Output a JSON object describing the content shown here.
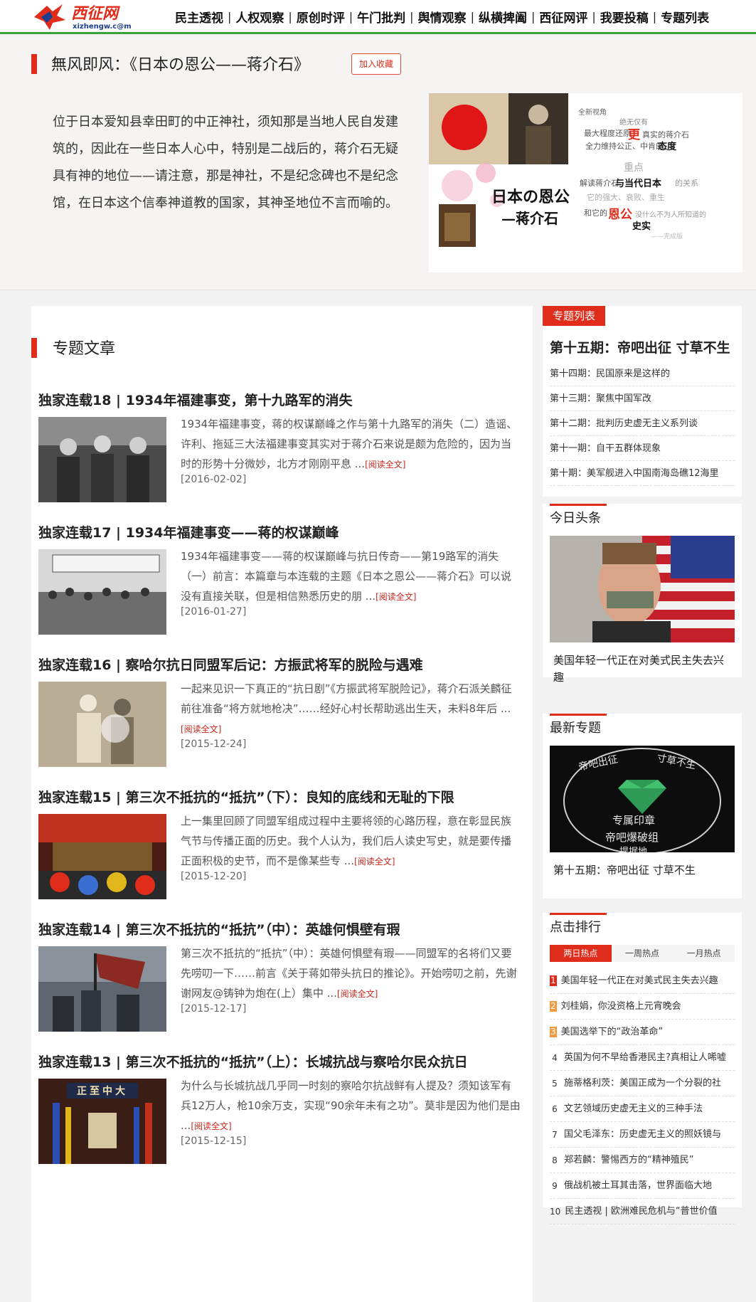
{
  "site": {
    "logo_text": "西征网",
    "logo_domain": "xizhengw.c@m"
  },
  "nav": [
    "民主透视",
    "人权观察",
    "原创时评",
    "午门批判",
    "舆情观察",
    "纵横捭阖",
    "西征网评",
    "我要投稿",
    "专题列表"
  ],
  "topic": {
    "title": "無风即风：《日本の恩公——蒋介石》",
    "favorite_label": "加入收藏",
    "description": "位于日本爱知县幸田町的中正神社，须知那是当地人民自发建筑的，因此在一些日本人心中，特别是二战后的，蒋介石无疑具有神的地位——请注意，那是神社，不是纪念碑也不是纪念馆，在日本这个信奉神道教的国家，其神圣地位不言而喻的。",
    "banner": {
      "title_line1": "日本の恩公",
      "title_line2": "—蒋介石",
      "side_text": [
        "全新视角",
        "绝无仅有",
        "最大程度还原",
        "更",
        "真实的蒋介石",
        "全力维持公正、中肯的",
        "态度",
        "重点",
        "解读蒋介石",
        "与当代日本",
        "的关系",
        "它的强大、衰败、重生",
        "和它的",
        "恩公",
        "没什么不为人所知道的",
        "史实",
        "——完成版"
      ]
    }
  },
  "articles_section": {
    "title": "专题文章",
    "read_more_label": "[阅读全文]",
    "items": [
      {
        "title": "独家连载18 | 1934年福建事变，第十九路军的消失",
        "summary": "1934年福建事变，蒋的权谋巅峰之作与第十九路军的消失（二）造谣、许利、拖延三大法福建事变其实对于蒋介石来说是颇为危险的，因为当时的形势十分微妙，北方才刚刚平息 ...",
        "date": "[2016-02-02]",
        "thumb": "three-officers-photo"
      },
      {
        "title": "独家连载17 | 1934年福建事变——蒋的权谋巅峰",
        "summary": "1934年福建事变——蒋的权谋巅峰与抗日传奇——第19路军的消失（一）前言：本篇章与本连载的主题《日本之恩公——蒋介石》可以说没有直接关联，但是相信熟悉历史的朋 ...",
        "date": "[2016-01-27]",
        "thumb": "assembly-crowd-photo"
      },
      {
        "title": "独家连载16 | 察哈尔抗日同盟军后记：方振武将军的脱险与遇难",
        "summary": "一起来见识一下真正的“抗日剧”《方振武将军脱险记》，蒋介石派关麟征前往准备“将方就地枪决”……经好心村长帮助逃出生天，未料8年后 ...",
        "date": "[2015-12-24]",
        "thumb": "two-men-photo"
      },
      {
        "title": "独家连载15 | 第三次不抵抗的“抵抗”（下）：良知的底线和无耻的下限",
        "summary": "上一集里回顾了同盟军组成过程中主要将领的心路历程，意在彰显民族气节与传播正面的历史。我个人认为，我们后人读史写史，就是要传播正面积极的史节，而不是像某些专 ...",
        "date": "[2015-12-20]",
        "thumb": "ceremony-red-photo"
      },
      {
        "title": "独家连载14 | 第三次不抵抗的“抵抗”（中）：英雄何惧壁有瑕",
        "summary": "第三次不抵抗的“抵抗”（中）：英雄何惧壁有瑕——同盟军的名将们又要先唠叨一下……前言《关于蒋如带头抗日的推论》。开始唠叨之前，先谢谢网友@铸钟为炮在(上）集中 ...",
        "date": "[2015-12-17]",
        "thumb": "soldiers-flag-photo"
      },
      {
        "title": "独家连载13 | 第三次不抵抗的“抵抗”（上）：长城抗战与察哈尔民众抗日",
        "summary": "为什么与长城抗战几乎同一时刻的察哈尔抗战鲜有人提及？须知该军有兵12万人，枪10余万支，实现“90余年未有之功”。莫非是因为他们是由 ...",
        "date": "[2015-12-15]",
        "thumb": "hall-flags-photo",
        "thumb_plaque": "正至中大"
      }
    ]
  },
  "sidebar": {
    "topics": {
      "tag": "专题列表",
      "headline": "第十五期：帝吧出征 寸草不生",
      "items": [
        "第十四期：民国原来是这样的",
        "第十三期：聚焦中国军改",
        "第十二期：批判历史虚无主义系列谈",
        "第十一期：自干五群体现象",
        "第十期：美军舰进入中国南海岛礁12海里"
      ]
    },
    "headline_today": {
      "title": "今日头条",
      "caption": "美国年轻一代正在对美式民主失去兴趣"
    },
    "newest_topic": {
      "title": "最新专题",
      "caption": "第十五期：帝吧出征 寸草不生",
      "image_text": [
        "帝吧出征",
        "寸草不生",
        "专属印章",
        "帝吧爆破组",
        "提据地"
      ]
    },
    "ranking": {
      "title": "点击排行",
      "tabs": [
        "两日热点",
        "一周热点",
        "一月热点"
      ],
      "items": [
        {
          "num": "1",
          "text": "美国年轻一代正在对美式民主失去兴趣"
        },
        {
          "num": "2",
          "text": "刘桂娟，你没资格上元宵晚会"
        },
        {
          "num": "3",
          "text": "美国选举下的“政治革命”"
        },
        {
          "num": "4",
          "text": "英国为何不早给香港民主?真相让人唏嘘"
        },
        {
          "num": "5",
          "text": "施蒂格利茨：美国正成为一个分裂的社"
        },
        {
          "num": "6",
          "text": "文艺领域历史虚无主义的三种手法"
        },
        {
          "num": "7",
          "text": "国父毛泽东：历史虚无主义的照妖镜与"
        },
        {
          "num": "8",
          "text": "郑若麟：警惕西方的“精神殖民”"
        },
        {
          "num": "9",
          "text": "俄战机被土耳其击落，世界面临大地"
        },
        {
          "num": "10",
          "text": "民主透视 | 欧洲难民危机与“普世价值"
        }
      ]
    }
  },
  "colors": {
    "accent_red": "#e02d1b",
    "nav_underline_green": "#3aa23a",
    "rank_orange": "#f19a3e"
  }
}
